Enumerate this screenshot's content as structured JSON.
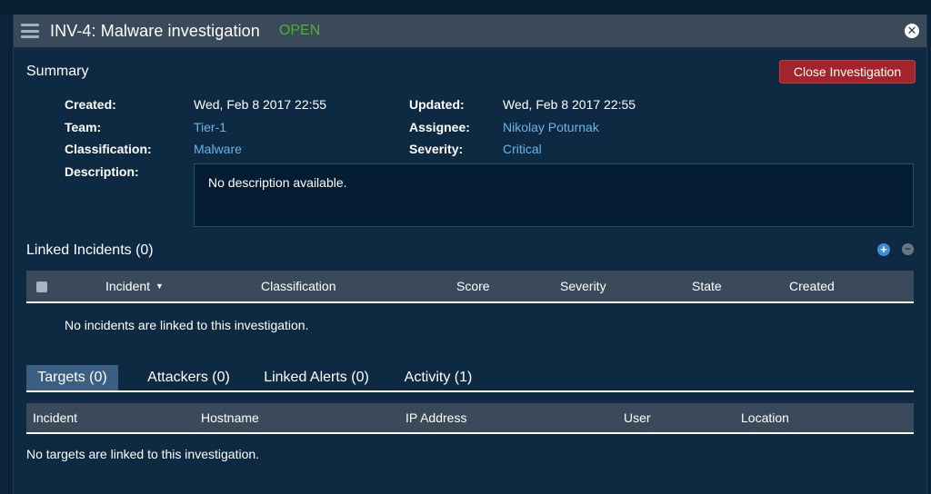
{
  "window": {
    "title": "INV-4: Malware investigation",
    "status": "OPEN",
    "close_symbol": "✕",
    "status_color": "#4caf2e"
  },
  "summary": {
    "heading": "Summary",
    "close_button": "Close Investigation",
    "created_label": "Created:",
    "created_value": "Wed, Feb 8 2017 22:55",
    "updated_label": "Updated:",
    "updated_value": "Wed, Feb 8 2017 22:55",
    "team_label": "Team:",
    "team_value": "Tier-1",
    "assignee_label": "Assignee:",
    "assignee_value": "Nikolay Poturnak",
    "classification_label": "Classification:",
    "classification_value": "Malware",
    "severity_label": "Severity:",
    "severity_value": "Critical",
    "description_label": "Description:",
    "description_value": "No description available."
  },
  "linked_incidents": {
    "heading": "Linked Incidents (0)",
    "add_icon": "+",
    "remove_icon": "−",
    "columns": [
      "Incident",
      "Classification",
      "Score",
      "Severity",
      "State",
      "Created"
    ],
    "sort_indicator": "▼",
    "empty_message": "No incidents are linked to this investigation."
  },
  "tabs": {
    "items": [
      "Targets (0)",
      "Attackers (0)",
      "Linked Alerts (0)",
      "Activity (1)"
    ],
    "active": "Targets (0)"
  },
  "targets": {
    "columns": [
      "Incident",
      "Hostname",
      "IP Address",
      "User",
      "Location"
    ],
    "empty_message": "No targets are linked to this investigation."
  }
}
